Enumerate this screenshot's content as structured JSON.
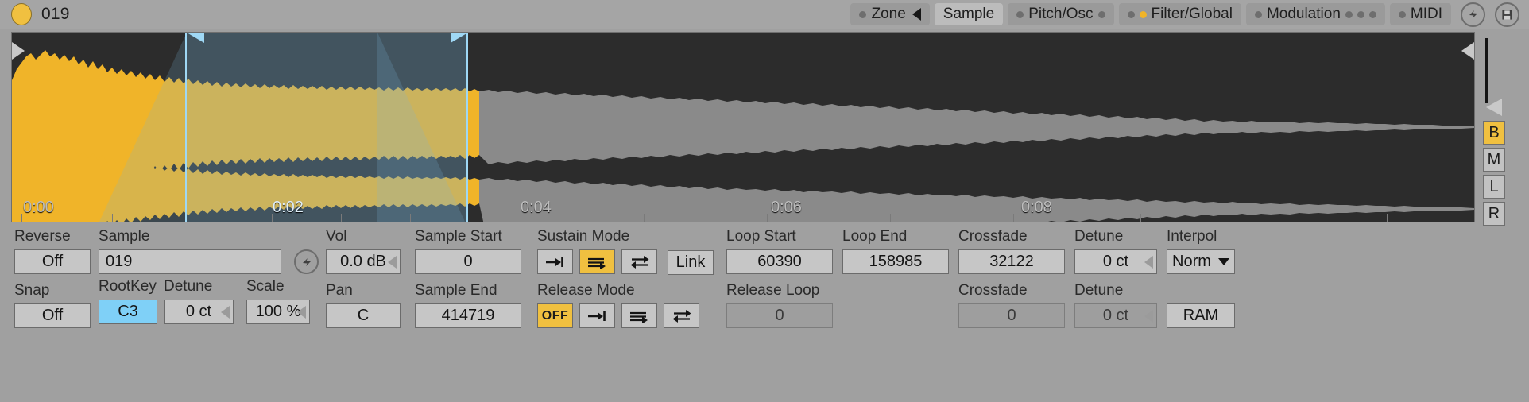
{
  "device": {
    "name": "019",
    "power_dot": "power-led",
    "accent": "#f0c040"
  },
  "tabs": [
    {
      "label": "Zone",
      "active": false,
      "leds": [
        "off"
      ],
      "caret": true
    },
    {
      "label": "Sample",
      "active": true,
      "leds": [],
      "caret": false
    },
    {
      "label": "Pitch/Osc",
      "active": false,
      "leds": [
        "off"
      ],
      "leds_after": [
        "off"
      ]
    },
    {
      "label": "Filter/Global",
      "active": false,
      "leds": [
        "off",
        "on"
      ]
    },
    {
      "label": "Modulation",
      "active": false,
      "leds": [
        "off"
      ],
      "leds_after": [
        "off",
        "off",
        "off"
      ]
    },
    {
      "label": "MIDI",
      "active": false,
      "leds": [
        "off"
      ]
    }
  ],
  "titlebar_icons": [
    {
      "name": "hot-swap-icon",
      "glyph": "↯"
    },
    {
      "name": "save-preset-icon",
      "glyph": "▣"
    }
  ],
  "waveform": {
    "time_labels": [
      "0:00",
      "0:02",
      "0:04",
      "0:06",
      "0:08"
    ],
    "channels": 2,
    "waveform_color": "#f0b429",
    "inactive_color": "#8a8a8a",
    "selection_color": "#9fd8f5",
    "background": "#2c2c2c"
  },
  "rail": {
    "buttons": [
      {
        "label": "B",
        "active": true
      },
      {
        "label": "M",
        "active": false
      },
      {
        "label": "L",
        "active": false
      },
      {
        "label": "R",
        "active": false
      }
    ]
  },
  "params": {
    "reverse": {
      "label": "Reverse",
      "value": "Off"
    },
    "snap": {
      "label": "Snap",
      "value": "Off"
    },
    "sample": {
      "label": "Sample",
      "value": "019"
    },
    "rootkey": {
      "label": "RootKey",
      "value": "C3"
    },
    "detune_root": {
      "label": "Detune",
      "value": "0 ct"
    },
    "scale": {
      "label": "Scale",
      "value": "100 %"
    },
    "vol": {
      "label": "Vol",
      "value": "0.0 dB"
    },
    "pan": {
      "label": "Pan",
      "value": "C"
    },
    "sample_start": {
      "label": "Sample Start",
      "value": "0"
    },
    "sample_end": {
      "label": "Sample End",
      "value": "414719"
    },
    "sustain_mode": {
      "label": "Sustain Mode",
      "buttons": [
        {
          "icon": "no-loop-icon",
          "active": false
        },
        {
          "icon": "loop-forward-icon",
          "active": true
        },
        {
          "icon": "loop-pingpong-icon",
          "active": false
        }
      ]
    },
    "release_mode": {
      "label": "Release Mode",
      "buttons": [
        {
          "icon": "off-label",
          "active": true,
          "text": "OFF"
        },
        {
          "icon": "no-loop-icon",
          "active": false
        },
        {
          "icon": "loop-forward-icon",
          "active": false
        },
        {
          "icon": "loop-pingpong-icon",
          "active": false
        }
      ]
    },
    "link": {
      "label": "Link"
    },
    "loop_start": {
      "label": "Loop Start",
      "value": "60390"
    },
    "release_loop": {
      "label": "Release Loop",
      "value": "0"
    },
    "loop_end": {
      "label": "Loop End",
      "value": "158985"
    },
    "crossfade_sus": {
      "label": "Crossfade",
      "value": "32122"
    },
    "crossfade_rel": {
      "label": "Crossfade",
      "value": "0"
    },
    "detune_sus": {
      "label": "Detune",
      "value": "0 ct"
    },
    "detune_rel": {
      "label": "Detune",
      "value": "0 ct"
    },
    "interpol": {
      "label": "Interpol",
      "value": "Norm"
    },
    "ram": {
      "label": "RAM"
    }
  }
}
